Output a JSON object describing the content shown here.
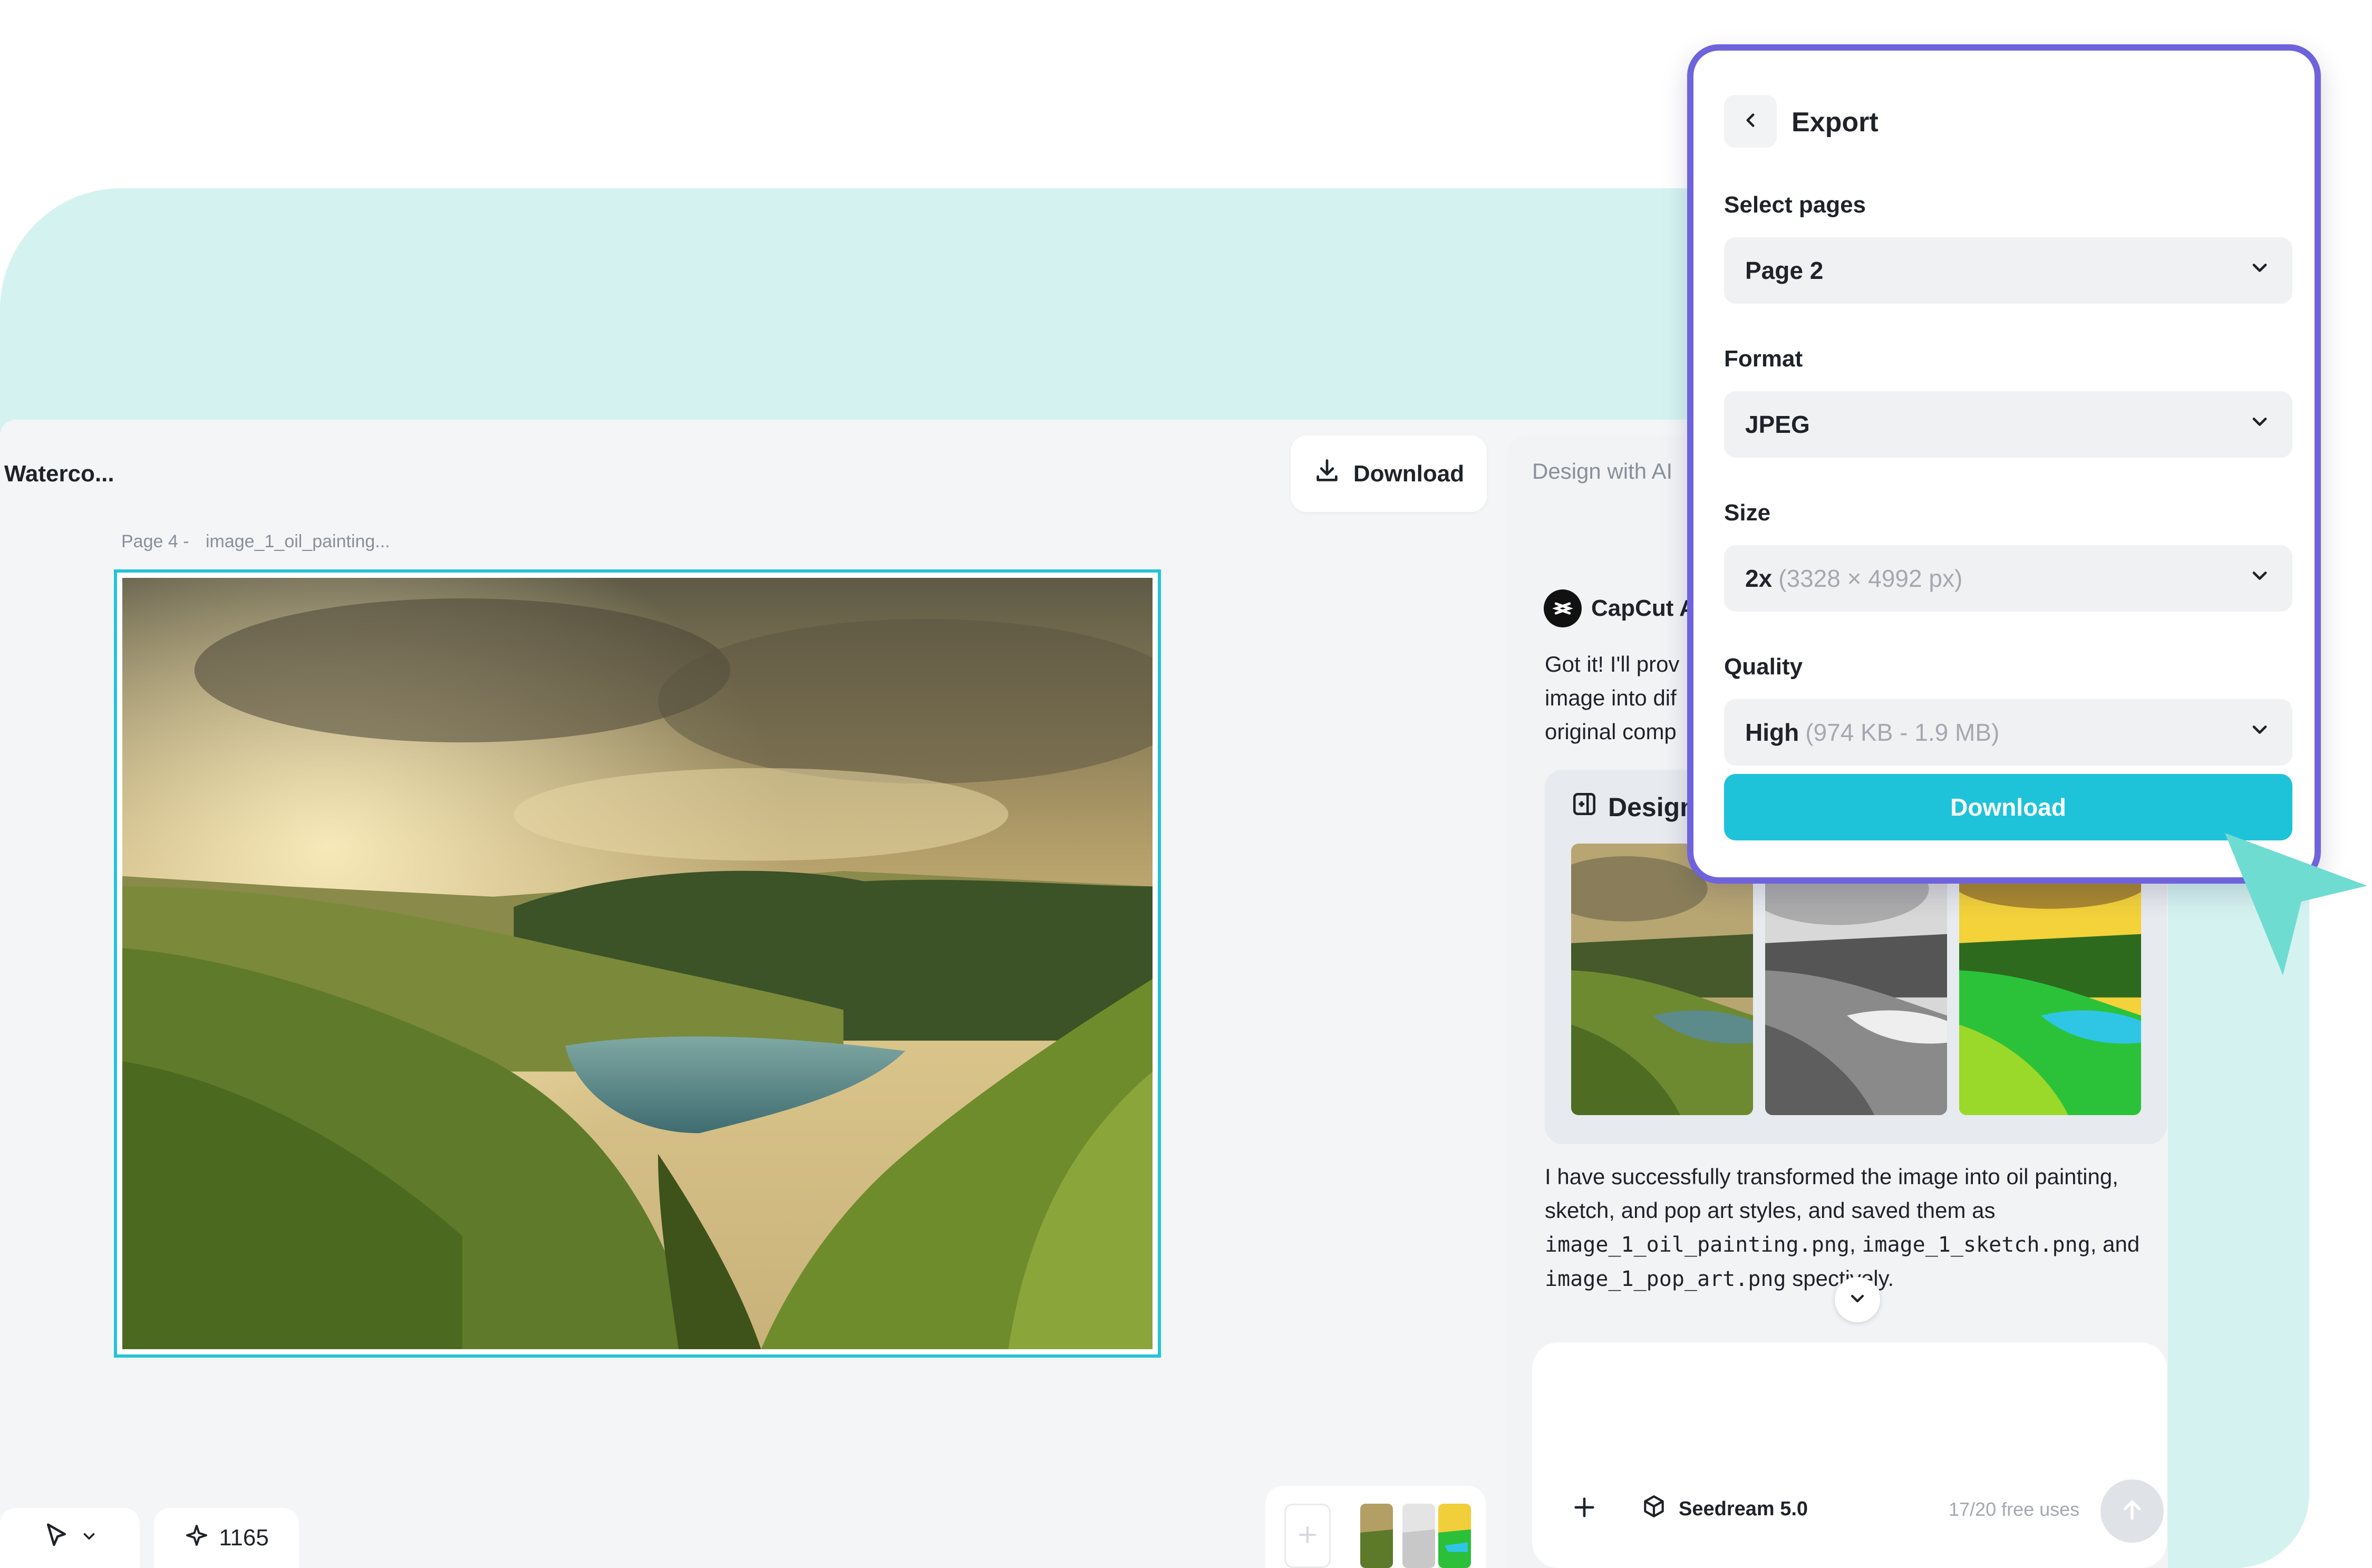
{
  "editor": {
    "doc_title": "Waterco...",
    "download_label": "Download",
    "page_number_label": "Page 4 -",
    "page_file_label": "image_1_oil_painting...",
    "credits": "1165"
  },
  "ai_panel": {
    "title": "Design with AI",
    "assistant_name": "CapCut A",
    "intro_lines": [
      "Got it! I'll prov",
      "image into dif",
      "original comp"
    ],
    "design_card_title": "Design",
    "result_text_1": "I have successfully transformed the image into oil painting, sketch, and pop art styles, and saved them as",
    "file_1": "image_1_oil_painting.png",
    "file_2": "image_1_sketch.png",
    "result_and": "and",
    "file_3": "image_1_pop_art.png",
    "result_end": "spectively.",
    "model_name": "Seedream 5.0",
    "free_uses": "17/20 free uses"
  },
  "export": {
    "title": "Export",
    "select_pages_label": "Select pages",
    "select_pages_value": "Page 2",
    "format_label": "Format",
    "format_value": "JPEG",
    "size_label": "Size",
    "size_value": "2x",
    "size_detail": "(3328 × 4992 px)",
    "quality_label": "Quality",
    "quality_value": "High",
    "quality_detail": "(974 KB - 1.9 MB)",
    "download_label": "Download"
  },
  "icons": {
    "download": "download-icon",
    "back": "chevron-left-icon",
    "chevron": "chevron-down-icon",
    "capcut": "capcut-logo-icon",
    "design": "design-card-icon",
    "add": "plus-icon",
    "model": "cube-icon",
    "send": "arrow-up-icon",
    "pointer": "pointer-icon",
    "sparkle": "sparkle-icon"
  },
  "colors": {
    "accent": "#1fc3d9",
    "export_border": "#6f63dd",
    "teal_background": "#d4f3f0",
    "cursor": "#6fdcd2"
  }
}
